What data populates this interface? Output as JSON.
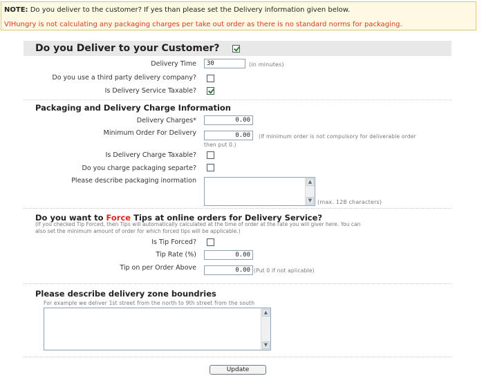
{
  "notice": {
    "note_label": "NOTE:",
    "line1": "Do you deliver to the customer? If yes than please set the Delivery information given below.",
    "line2": "VIHungry is not calculating any packaging charges per take out order as there is no standard norms for packaging."
  },
  "header": {
    "title": "Do you Deliver to your Customer?",
    "deliver_checked": true
  },
  "delivery": {
    "time_label": "Delivery Time",
    "time_value": "30",
    "time_unit": "(in minutes)",
    "third_party_label": "Do you use a third party delivery company?",
    "third_party_checked": false,
    "taxable_label": "Is Delivery Service Taxable?",
    "taxable_checked": true
  },
  "packaging": {
    "title": "Packaging and Delivery Charge Information",
    "charges_label": "Delivery Charges*",
    "charges_value": "0.00",
    "min_order_label": "Minimum Order For Delivery",
    "min_order_value": "0.00",
    "min_order_note1": "(If minimum order is not compulsory for deliverable order",
    "min_order_note2": "then put 0.)",
    "charge_taxable_label": "Is Delivery Charge Taxable?",
    "charge_taxable_checked": false,
    "separate_label": "Do you charge packaging separte?",
    "separate_checked": false,
    "describe_label": "Please describe packaging inormation",
    "describe_value": "",
    "max_note": "(max. 128 characters)"
  },
  "tips": {
    "title_pre": "Do you want to ",
    "title_red": "Force",
    "title_post": " Tips at online orders for Delivery Service?",
    "desc1": "(If you checked Tip Forced, then Tips will automatically calculated at the time of order at the rate you will giver here. You can",
    "desc2": "also set the minimum amount of order for which forced tips will be applicable.)",
    "forced_label": "Is Tip Forced?",
    "forced_checked": false,
    "rate_label": "Tip Rate (%)",
    "rate_value": "0.00",
    "above_label": "Tip on per Order Above",
    "above_value": "0.00",
    "above_note": "(Put 0 if not aplicable)"
  },
  "zone": {
    "title": "Please describe delivery zone boundries",
    "example": "For example we deliver 1st street from the north to 9th street from the south",
    "value": ""
  },
  "update_label": "Update"
}
